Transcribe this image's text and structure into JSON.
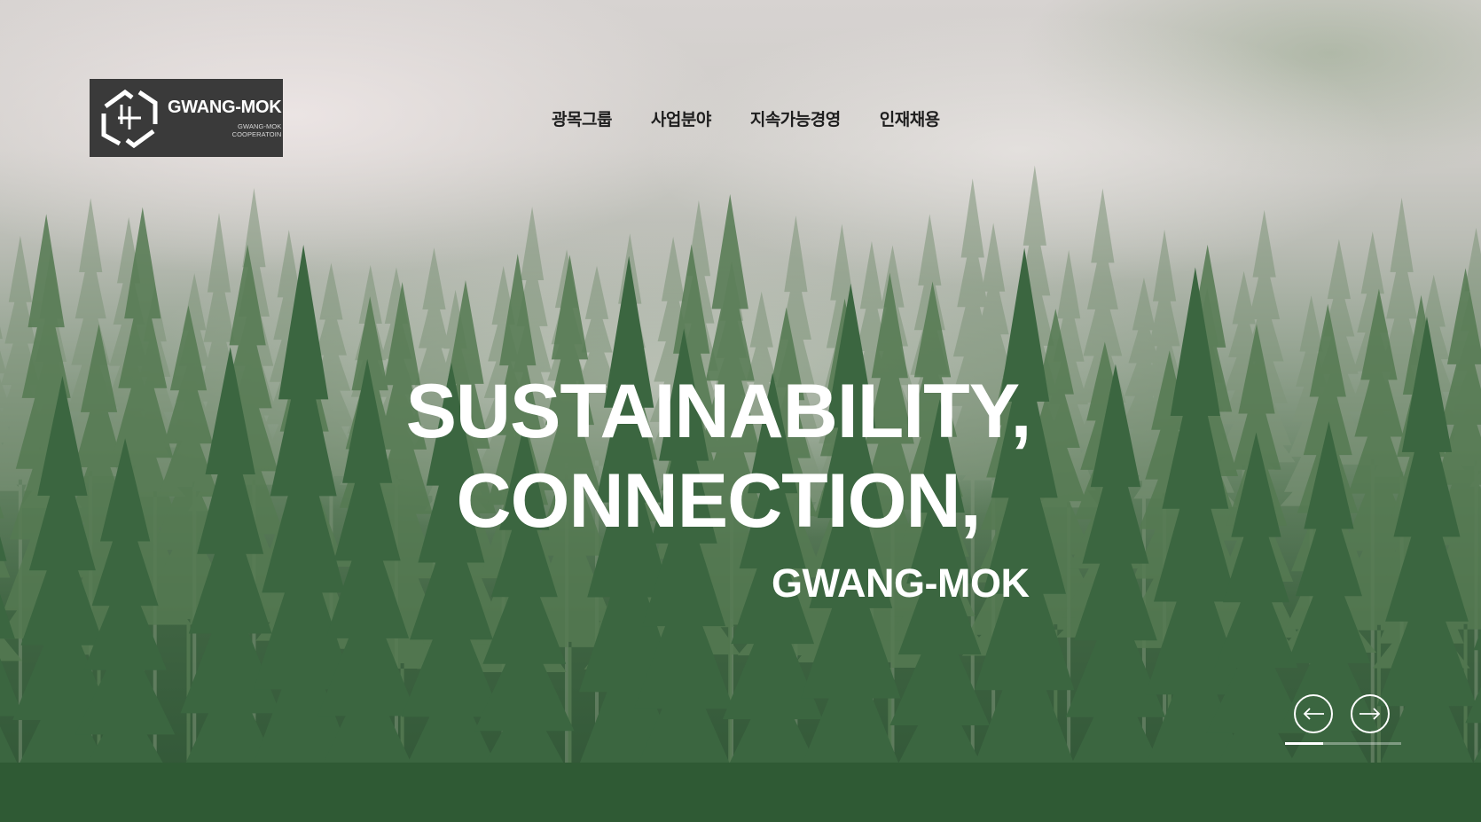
{
  "logo": {
    "title": "GWANG-MOK",
    "subtitle_line1": "GWANG-MOK",
    "subtitle_line2": "COOPERATOIN"
  },
  "nav": {
    "items": [
      {
        "label": "광목그룹"
      },
      {
        "label": "사업분야"
      },
      {
        "label": "지속가능경영"
      },
      {
        "label": "인재채용"
      }
    ]
  },
  "hero": {
    "line1": "SUSTAINABILITY,",
    "line2": "CONNECTION,",
    "line3": "GWANG-MOK"
  },
  "slider": {
    "prev_icon": "arrow-left-icon",
    "next_icon": "arrow-right-icon",
    "progress": 0.33
  },
  "colors": {
    "nav_text": "#1e1e1e",
    "logo_bg": "#3a3a3a",
    "hero_text": "#ffffff"
  }
}
